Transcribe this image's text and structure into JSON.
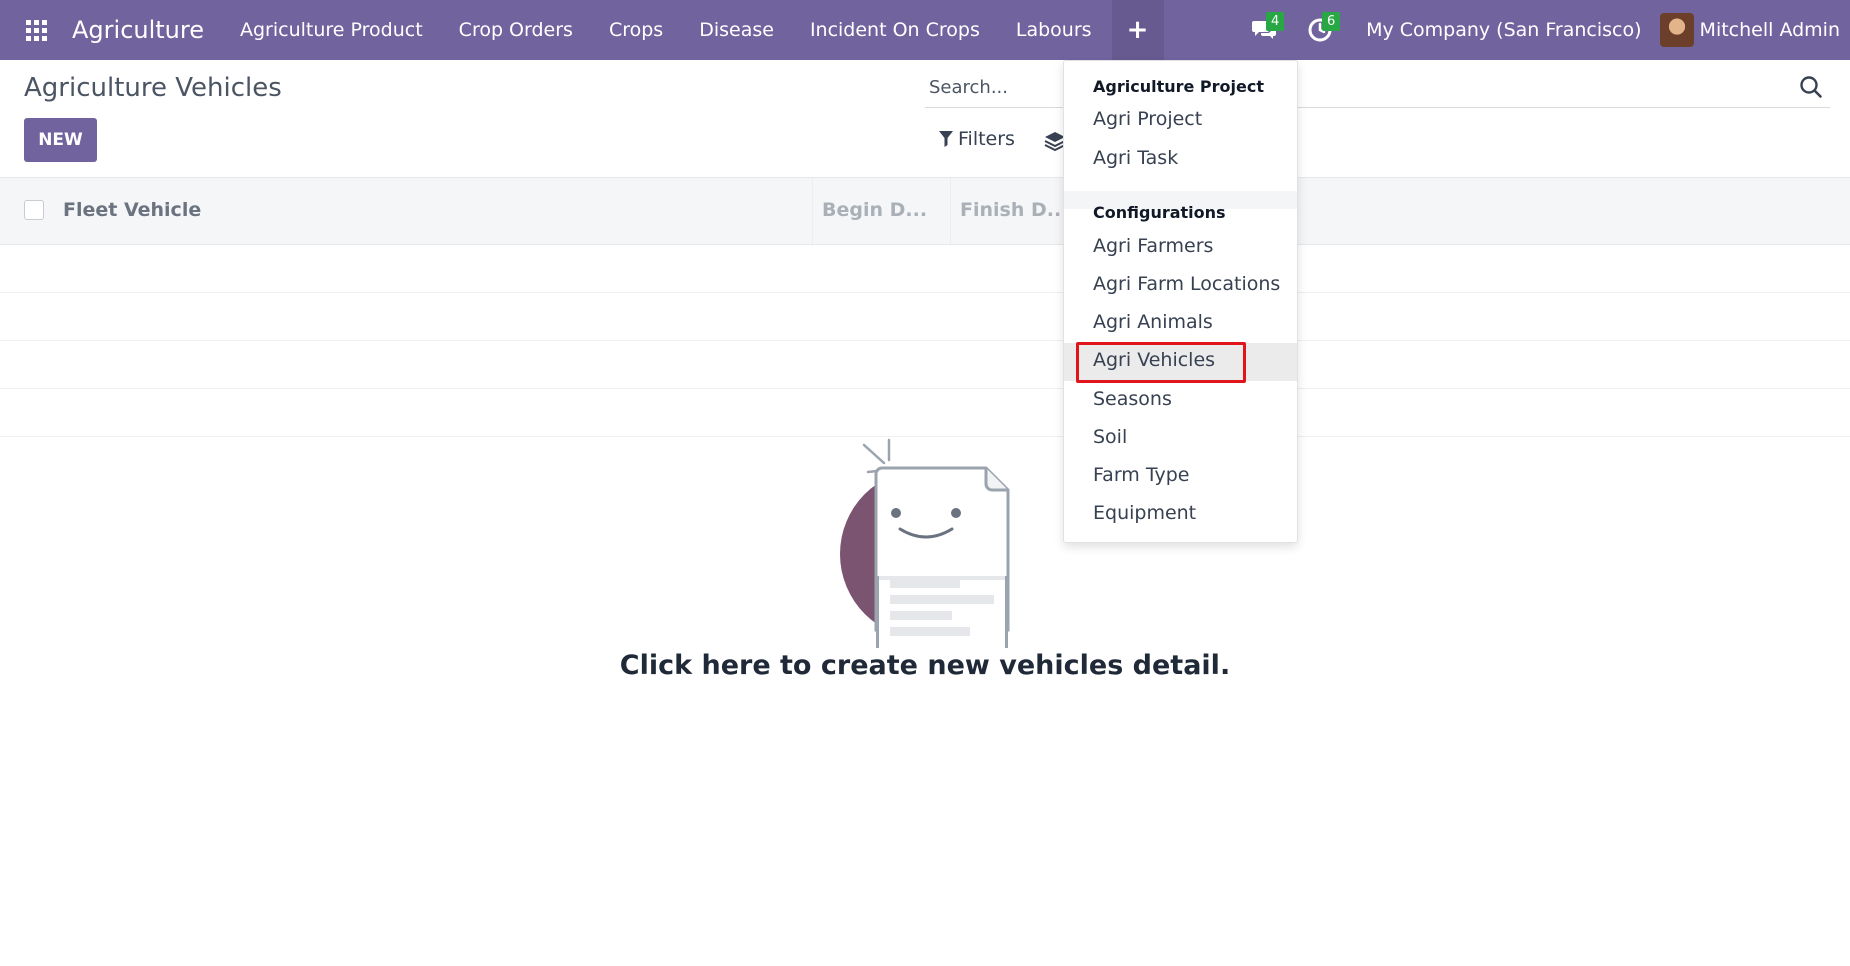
{
  "navbar": {
    "app_name": "Agriculture",
    "menu": [
      "Agriculture Product",
      "Crop Orders",
      "Crops",
      "Disease",
      "Incident On Crops",
      "Labours"
    ],
    "plus_label": "+",
    "messages_count": "4",
    "activities_count": "6",
    "company": "My Company (San Francisco)",
    "user": "Mitchell Admin"
  },
  "page": {
    "title": "Agriculture Vehicles",
    "new_label": "NEW",
    "search_placeholder": "Search...",
    "filters_label": "Filters"
  },
  "list": {
    "columns": [
      "Fleet Vehicle",
      "Begin D...",
      "Finish D..."
    ]
  },
  "empty": {
    "message": "Click here to create new vehicles detail."
  },
  "dropdown": {
    "section1": "Agriculture Project",
    "section1_items": [
      "Agri Project",
      "Agri Task"
    ],
    "section2": "Configurations",
    "section2_items": [
      "Agri Farmers",
      "Agri Farm Locations",
      "Agri Animals",
      "Agri Vehicles",
      "Seasons",
      "Soil",
      "Farm Type",
      "Equipment"
    ]
  },
  "colors": {
    "brand": "#71639e",
    "badge": "#28a745",
    "highlight": "#e0151b"
  }
}
